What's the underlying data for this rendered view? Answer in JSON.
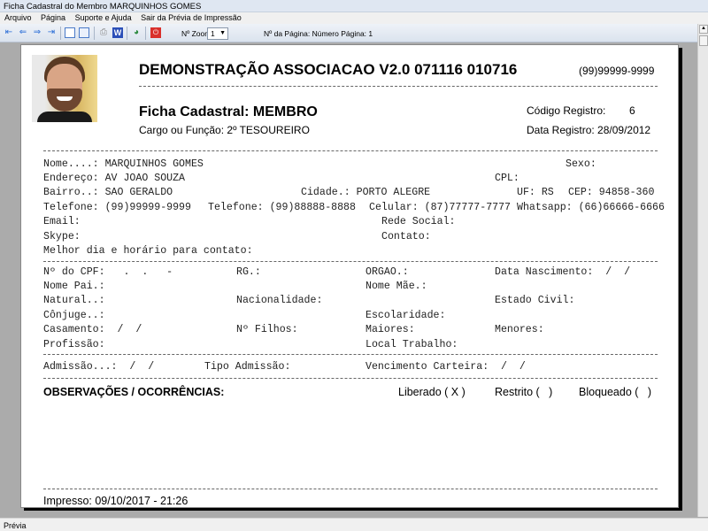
{
  "window": {
    "title": "Ficha Cadastral do Membro MARQUINHOS GOMES"
  },
  "menu": [
    "Arquivo",
    "Página",
    "Suporte e Ajuda",
    "Sair da Prévia de Impressão"
  ],
  "toolbar": {
    "zoom_label": "Nº Zoom",
    "zoom_value": "1",
    "page_label": "Nº da Página: Número Página: 1"
  },
  "status": "Prévia",
  "report": {
    "org_title": "DEMONSTRAÇÃO ASSOCIACAO V2.0 071116 010716",
    "org_phone": "(99)99999-9999",
    "form_title": "Ficha Cadastral: MEMBRO",
    "cargo": "Cargo ou Função: 2º TESOUREIRO",
    "codigo_label": "Código Registro:",
    "codigo_value": "6",
    "data_registro": "Data Registro: 28/09/2012",
    "fields": {
      "nome": "Nome....: MARQUINHOS GOMES",
      "sexo": "Sexo:",
      "endereco": "Endereço: AV JOAO SOUZA",
      "cpl": "CPL:",
      "bairro": "Bairro..: SAO GERALDO",
      "cidade": "Cidade.: PORTO ALEGRE",
      "uf": "UF: RS",
      "cep": "CEP: 94858-360",
      "telefone1": "Telefone: (99)99999-9999",
      "telefone2": "Telefone: (99)88888-8888",
      "celular": "Celular: (87)77777-7777",
      "whatsapp": "Whatsapp: (66)66666-6666",
      "email": "Email:",
      "rede_social": "Rede Social:",
      "skype": "Skype:",
      "contato": "Contato:",
      "melhor_dia": "Melhor dia e horário para contato:",
      "cpf": "Nº do CPF:   .  .   -",
      "rg": "RG.:",
      "orgao": "ORGAO.:",
      "nascimento": "Data Nascimento:  /  /",
      "pai": "Nome Pai.:",
      "mae": "Nome Mãe.:",
      "natural": "Natural..:",
      "nacionalidade": "Nacionalidade:",
      "estado_civil": "Estado Civil:",
      "conjuge": "Cônjuge..:",
      "escolaridade": "Escolaridade:",
      "casamento": "Casamento:  /  /",
      "filhos": "Nº Filhos:",
      "maiores": "Maiores:",
      "menores": "Menores:",
      "profissao": "Profissão:",
      "local_trabalho": "Local Trabalho:",
      "admissao": "Admissão...:  /  /",
      "tipo_admissao": "Tipo Admissão:",
      "vencimento": "Vencimento Carteira:  /  /"
    },
    "observacoes": "OBSERVAÇÕES / OCORRÊNCIAS:",
    "liberado": "Liberado ( X )",
    "restrito": "Restrito (   )",
    "bloqueado": "Bloqueado (   )",
    "impresso": "Impresso: 09/10/2017 - 21:26"
  }
}
